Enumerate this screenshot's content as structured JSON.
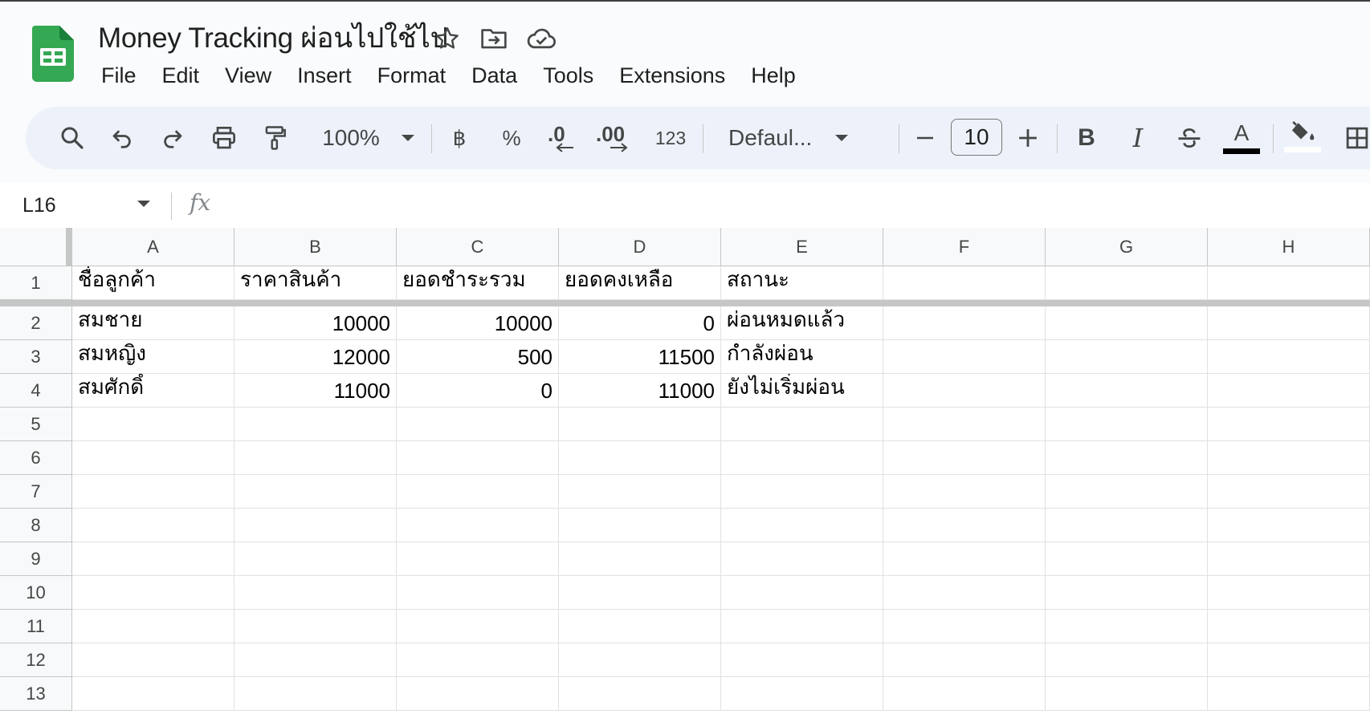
{
  "doc": {
    "title": "Money Tracking ผ่อนไปใช้ไป"
  },
  "menu": [
    "File",
    "Edit",
    "View",
    "Insert",
    "Format",
    "Data",
    "Tools",
    "Extensions",
    "Help"
  ],
  "toolbar": {
    "zoom": "100%",
    "currency": "฿",
    "percent": "%",
    "decrease_decimal": ".0",
    "increase_decimal": ".00",
    "number_format": "123",
    "font": "Defaul...",
    "font_size": "10",
    "bold": "B",
    "italic": "I",
    "text_color_letter": "A",
    "text_color": "#000000",
    "fill_color": "#ffffff"
  },
  "formula_bar": {
    "name_box": "L16",
    "fx": "fx"
  },
  "columns": [
    "A",
    "B",
    "C",
    "D",
    "E",
    "F",
    "G",
    "H"
  ],
  "rows": [
    "1",
    "2",
    "3",
    "4",
    "5",
    "6",
    "7",
    "8",
    "9",
    "10",
    "11",
    "12",
    "13"
  ],
  "cells": {
    "A1": "ชื่อลูกค้า",
    "B1": "ราคาสินค้า",
    "C1": "ยอดชำระรวม",
    "D1": "ยอดคงเหลือ",
    "E1": "สถานะ",
    "A2": "สมชาย",
    "B2": "10000",
    "C2": "10000",
    "D2": "0",
    "E2": "ผ่อนหมดแล้ว",
    "A3": "สมหญิง",
    "B3": "12000",
    "C3": "500",
    "D3": "11500",
    "E3": "กำลังผ่อน",
    "A4": "สมศักดิ์",
    "B4": "11000",
    "C4": "0",
    "D4": "11000",
    "E4": "ยังไม่เริ่มผ่อน"
  },
  "numeric_columns": [
    "B",
    "C",
    "D"
  ],
  "colors": {
    "accent": "#0f9d58",
    "toolbar_bg": "#edf2fa",
    "header_bg": "#f8f9fa"
  }
}
